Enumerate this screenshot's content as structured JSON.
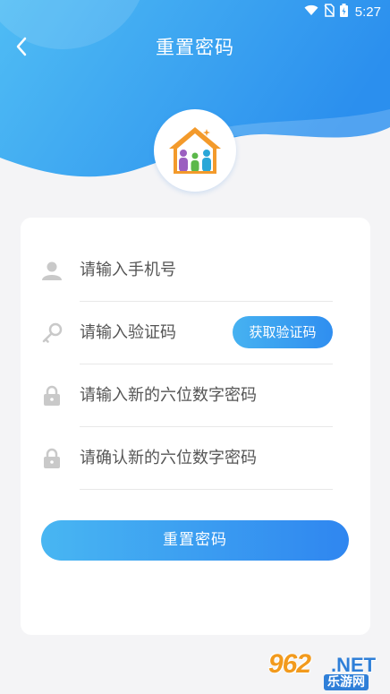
{
  "status_bar": {
    "time": "5:27",
    "icons": [
      "wifi-icon",
      "no-sim-icon",
      "battery-charging-icon"
    ]
  },
  "header": {
    "title": "重置密码",
    "back_icon": "chevron-left-icon"
  },
  "form": {
    "phone_placeholder": "请输入手机号",
    "code_placeholder": "请输入验证码",
    "get_code_label": "获取验证码",
    "new_password_placeholder": "请输入新的六位数字密码",
    "confirm_password_placeholder": "请确认新的六位数字密码",
    "submit_label": "重置密码"
  },
  "watermark": {
    "number": "962",
    "domain": ".NET",
    "site": "乐游网"
  },
  "colors": {
    "primary": "#2f8ef0",
    "header_light": "#5cc3f6",
    "logo_orange": "#f39a2b"
  }
}
